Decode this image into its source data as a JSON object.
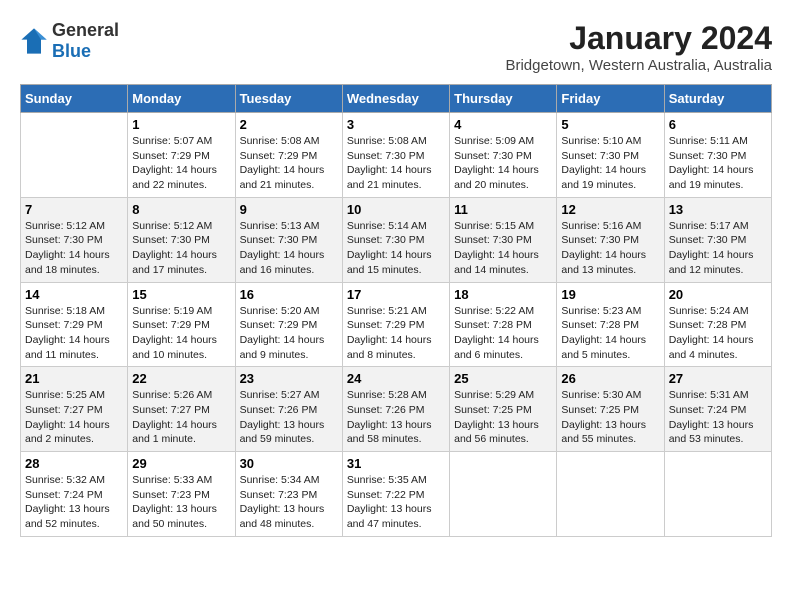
{
  "logo": {
    "text1": "General",
    "text2": "Blue"
  },
  "title": "January 2024",
  "subtitle": "Bridgetown, Western Australia, Australia",
  "days_header": [
    "Sunday",
    "Monday",
    "Tuesday",
    "Wednesday",
    "Thursday",
    "Friday",
    "Saturday"
  ],
  "weeks": [
    [
      {
        "day": "",
        "info": ""
      },
      {
        "day": "1",
        "info": "Sunrise: 5:07 AM\nSunset: 7:29 PM\nDaylight: 14 hours\nand 22 minutes."
      },
      {
        "day": "2",
        "info": "Sunrise: 5:08 AM\nSunset: 7:29 PM\nDaylight: 14 hours\nand 21 minutes."
      },
      {
        "day": "3",
        "info": "Sunrise: 5:08 AM\nSunset: 7:30 PM\nDaylight: 14 hours\nand 21 minutes."
      },
      {
        "day": "4",
        "info": "Sunrise: 5:09 AM\nSunset: 7:30 PM\nDaylight: 14 hours\nand 20 minutes."
      },
      {
        "day": "5",
        "info": "Sunrise: 5:10 AM\nSunset: 7:30 PM\nDaylight: 14 hours\nand 19 minutes."
      },
      {
        "day": "6",
        "info": "Sunrise: 5:11 AM\nSunset: 7:30 PM\nDaylight: 14 hours\nand 19 minutes."
      }
    ],
    [
      {
        "day": "7",
        "info": "Sunrise: 5:12 AM\nSunset: 7:30 PM\nDaylight: 14 hours\nand 18 minutes."
      },
      {
        "day": "8",
        "info": "Sunrise: 5:12 AM\nSunset: 7:30 PM\nDaylight: 14 hours\nand 17 minutes."
      },
      {
        "day": "9",
        "info": "Sunrise: 5:13 AM\nSunset: 7:30 PM\nDaylight: 14 hours\nand 16 minutes."
      },
      {
        "day": "10",
        "info": "Sunrise: 5:14 AM\nSunset: 7:30 PM\nDaylight: 14 hours\nand 15 minutes."
      },
      {
        "day": "11",
        "info": "Sunrise: 5:15 AM\nSunset: 7:30 PM\nDaylight: 14 hours\nand 14 minutes."
      },
      {
        "day": "12",
        "info": "Sunrise: 5:16 AM\nSunset: 7:30 PM\nDaylight: 14 hours\nand 13 minutes."
      },
      {
        "day": "13",
        "info": "Sunrise: 5:17 AM\nSunset: 7:30 PM\nDaylight: 14 hours\nand 12 minutes."
      }
    ],
    [
      {
        "day": "14",
        "info": "Sunrise: 5:18 AM\nSunset: 7:29 PM\nDaylight: 14 hours\nand 11 minutes."
      },
      {
        "day": "15",
        "info": "Sunrise: 5:19 AM\nSunset: 7:29 PM\nDaylight: 14 hours\nand 10 minutes."
      },
      {
        "day": "16",
        "info": "Sunrise: 5:20 AM\nSunset: 7:29 PM\nDaylight: 14 hours\nand 9 minutes."
      },
      {
        "day": "17",
        "info": "Sunrise: 5:21 AM\nSunset: 7:29 PM\nDaylight: 14 hours\nand 8 minutes."
      },
      {
        "day": "18",
        "info": "Sunrise: 5:22 AM\nSunset: 7:28 PM\nDaylight: 14 hours\nand 6 minutes."
      },
      {
        "day": "19",
        "info": "Sunrise: 5:23 AM\nSunset: 7:28 PM\nDaylight: 14 hours\nand 5 minutes."
      },
      {
        "day": "20",
        "info": "Sunrise: 5:24 AM\nSunset: 7:28 PM\nDaylight: 14 hours\nand 4 minutes."
      }
    ],
    [
      {
        "day": "21",
        "info": "Sunrise: 5:25 AM\nSunset: 7:27 PM\nDaylight: 14 hours\nand 2 minutes."
      },
      {
        "day": "22",
        "info": "Sunrise: 5:26 AM\nSunset: 7:27 PM\nDaylight: 14 hours\nand 1 minute."
      },
      {
        "day": "23",
        "info": "Sunrise: 5:27 AM\nSunset: 7:26 PM\nDaylight: 13 hours\nand 59 minutes."
      },
      {
        "day": "24",
        "info": "Sunrise: 5:28 AM\nSunset: 7:26 PM\nDaylight: 13 hours\nand 58 minutes."
      },
      {
        "day": "25",
        "info": "Sunrise: 5:29 AM\nSunset: 7:25 PM\nDaylight: 13 hours\nand 56 minutes."
      },
      {
        "day": "26",
        "info": "Sunrise: 5:30 AM\nSunset: 7:25 PM\nDaylight: 13 hours\nand 55 minutes."
      },
      {
        "day": "27",
        "info": "Sunrise: 5:31 AM\nSunset: 7:24 PM\nDaylight: 13 hours\nand 53 minutes."
      }
    ],
    [
      {
        "day": "28",
        "info": "Sunrise: 5:32 AM\nSunset: 7:24 PM\nDaylight: 13 hours\nand 52 minutes."
      },
      {
        "day": "29",
        "info": "Sunrise: 5:33 AM\nSunset: 7:23 PM\nDaylight: 13 hours\nand 50 minutes."
      },
      {
        "day": "30",
        "info": "Sunrise: 5:34 AM\nSunset: 7:23 PM\nDaylight: 13 hours\nand 48 minutes."
      },
      {
        "day": "31",
        "info": "Sunrise: 5:35 AM\nSunset: 7:22 PM\nDaylight: 13 hours\nand 47 minutes."
      },
      {
        "day": "",
        "info": ""
      },
      {
        "day": "",
        "info": ""
      },
      {
        "day": "",
        "info": ""
      }
    ]
  ]
}
